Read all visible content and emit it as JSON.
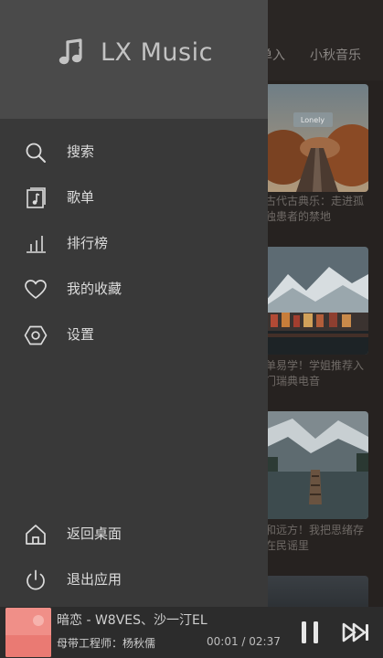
{
  "app": {
    "name": "LX Music"
  },
  "background": {
    "tabs": [
      "单入",
      "小秋音乐"
    ],
    "cards": [
      {
        "image_text": "Lonely",
        "title": "古代古典乐：走进孤独患者的禁地"
      },
      {
        "title": "单易学！学姐推荐入门瑞典电音"
      },
      {
        "title": "和远方！我把思绪存在民谣里"
      }
    ]
  },
  "drawer": {
    "menu": [
      {
        "id": "search",
        "icon": "search-icon",
        "label": "搜索"
      },
      {
        "id": "songlist",
        "icon": "songlist-icon",
        "label": "歌单"
      },
      {
        "id": "leaderboard",
        "icon": "leaderboard-icon",
        "label": "排行榜"
      },
      {
        "id": "favorites",
        "icon": "heart-icon",
        "label": "我的收藏"
      },
      {
        "id": "settings",
        "icon": "settings-icon",
        "label": "设置"
      }
    ],
    "bottom_menu": [
      {
        "id": "home",
        "icon": "home-icon",
        "label": "返回桌面"
      },
      {
        "id": "exit",
        "icon": "power-icon",
        "label": "退出应用"
      }
    ]
  },
  "player": {
    "song_line": "暗恋 - W8VES、沙一汀EL",
    "sub_line": "母带工程师：杨秋儒",
    "time": "00:01 / 02:37",
    "progress": 0.006
  },
  "colors": {
    "drawer_bg": "#393939",
    "drawer_header_bg": "#4a4a4a",
    "player_bg": "#2c2c2c",
    "text": "#dcdcdc"
  }
}
